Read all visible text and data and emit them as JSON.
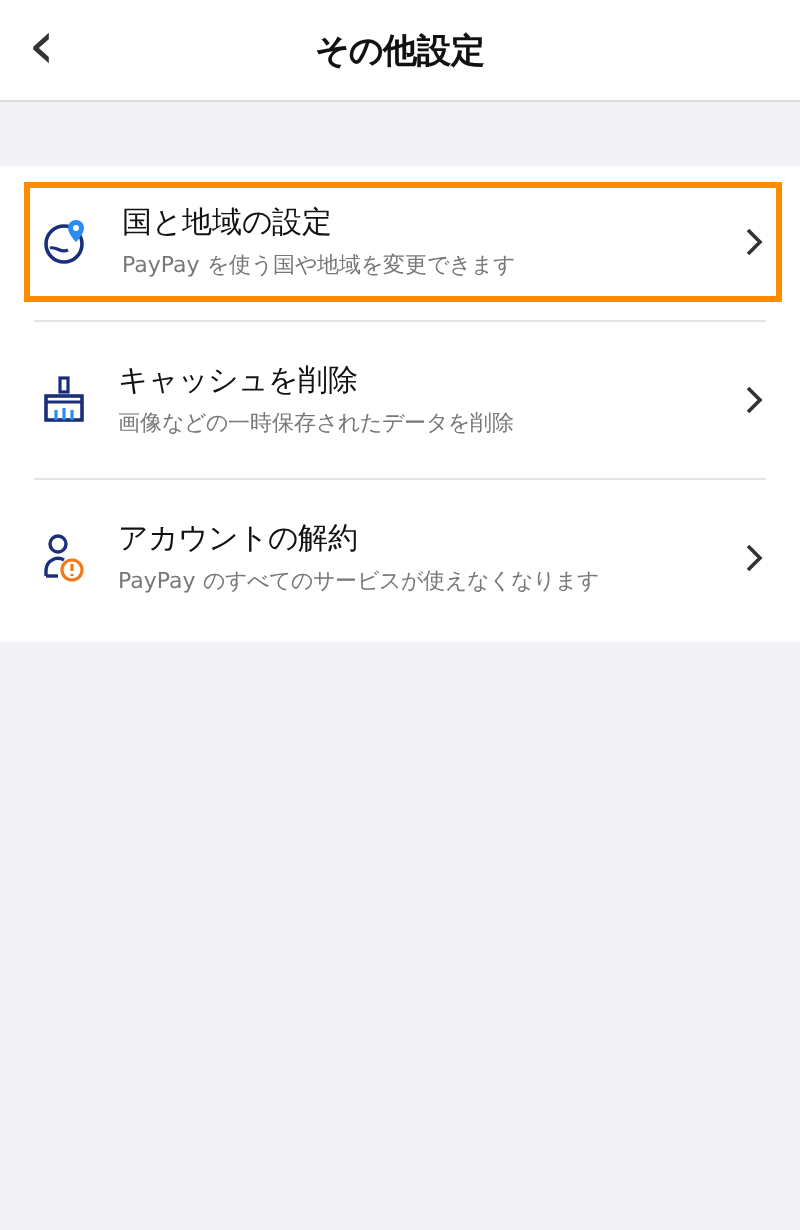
{
  "header": {
    "title": "その他設定",
    "back": "‹"
  },
  "items": [
    {
      "kind": "globe",
      "title": "国と地域の設定",
      "subtitle": "PayPay を使う国や地域を変更できます",
      "selected": true
    },
    {
      "kind": "brush",
      "title": "キャッシュを削除",
      "subtitle": "画像などの一時保存されたデータを削除",
      "selected": false
    },
    {
      "kind": "account",
      "title": "アカウントの解約",
      "subtitle": "PayPay のすべてのサービスが使えなくなります",
      "selected": false
    }
  ]
}
